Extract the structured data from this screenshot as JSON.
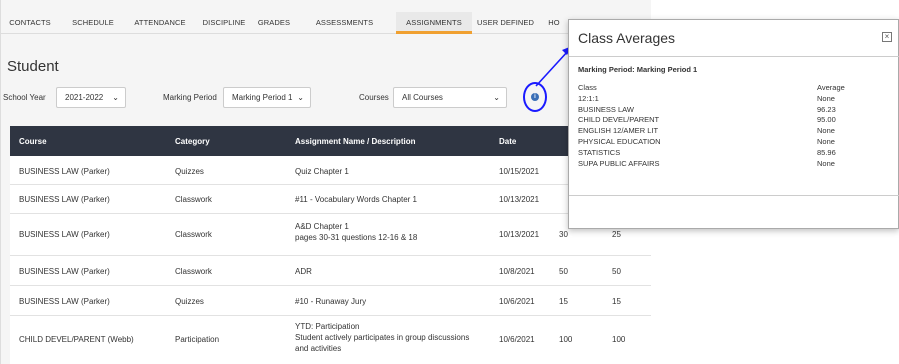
{
  "tabs": [
    {
      "label": "CONTACTS",
      "active": false
    },
    {
      "label": "SCHEDULE",
      "active": false
    },
    {
      "label": "ATTENDANCE",
      "active": false
    },
    {
      "label": "DISCIPLINE",
      "active": false
    },
    {
      "label": "GRADES",
      "active": false
    },
    {
      "label": "ASSESSMENTS",
      "active": false
    },
    {
      "label": "ASSIGNMENTS",
      "active": true
    },
    {
      "label": "USER DEFINED",
      "active": false
    },
    {
      "label": "HO",
      "active": false
    }
  ],
  "page": {
    "title": "Student"
  },
  "filters": {
    "school_year_label": "School Year",
    "school_year_value": "2021-2022",
    "marking_period_label": "Marking Period",
    "marking_period_value": "Marking Period 1",
    "courses_label": "Courses",
    "courses_value": "All Courses",
    "info_glyph": "i"
  },
  "table": {
    "headers": {
      "course": "Course",
      "category": "Category",
      "assignment": "Assignment Name / Description",
      "date": "Date"
    },
    "rows": [
      {
        "course": "BUSINESS LAW (Parker)",
        "category": "Quizzes",
        "assignment": [
          "Quiz Chapter 1"
        ],
        "date": "10/15/2021",
        "score": "",
        "max": ""
      },
      {
        "course": "BUSINESS LAW (Parker)",
        "category": "Classwork",
        "assignment": [
          "#11 - Vocabulary Words Chapter 1"
        ],
        "date": "10/13/2021",
        "score": "",
        "max": ""
      },
      {
        "course": "BUSINESS LAW (Parker)",
        "category": "Classwork",
        "assignment": [
          "A&D Chapter 1",
          " pages 30-31 questions 12-16 & 18"
        ],
        "date": "10/13/2021",
        "score": "30",
        "max": "25"
      },
      {
        "course": "BUSINESS LAW (Parker)",
        "category": "Classwork",
        "assignment": [
          "ADR"
        ],
        "date": "10/8/2021",
        "score": "50",
        "max": "50"
      },
      {
        "course": "BUSINESS LAW (Parker)",
        "category": "Quizzes",
        "assignment": [
          "#10 - Runaway Jury"
        ],
        "date": "10/6/2021",
        "score": "15",
        "max": "15"
      },
      {
        "course": "CHILD DEVEL/PARENT (Webb)",
        "category": "Participation",
        "assignment": [
          "YTD: Participation",
          " Student actively participates in group discussions",
          " and activities"
        ],
        "date": "10/6/2021",
        "score": "100",
        "max": "100"
      }
    ]
  },
  "modal": {
    "title": "Class Averages",
    "close_glyph": "×",
    "marking_period": "Marking Period:  Marking Period 1",
    "col_class": "Class",
    "col_average": "Average",
    "rows": [
      {
        "class": "12:1:1",
        "average": "None"
      },
      {
        "class": "BUSINESS LAW",
        "average": "96.23"
      },
      {
        "class": "CHILD DEVEL/PARENT",
        "average": "95.00"
      },
      {
        "class": "ENGLISH 12/AMER LIT",
        "average": "None"
      },
      {
        "class": "PHYSICAL EDUCATION",
        "average": "None"
      },
      {
        "class": "STATISTICS",
        "average": "85.96"
      },
      {
        "class": "SUPA PUBLIC AFFAIRS",
        "average": "None"
      }
    ]
  },
  "colors": {
    "accent": "#f0a030",
    "header_bg": "#2f3542",
    "annotation": "#1a1aff",
    "info": "#3b6fb6"
  }
}
